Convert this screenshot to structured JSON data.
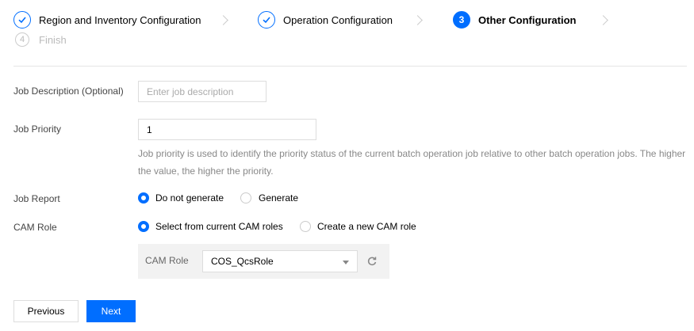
{
  "steps": [
    {
      "label": "Region and Inventory Configuration",
      "number": "",
      "state": "done"
    },
    {
      "label": "Operation Configuration",
      "number": "",
      "state": "done"
    },
    {
      "label": "Other Configuration",
      "number": "3",
      "state": "active"
    },
    {
      "label": "Finish",
      "number": "4",
      "state": "pending"
    }
  ],
  "form": {
    "job_description": {
      "label": "Job Description (Optional)",
      "placeholder": "Enter job description",
      "value": ""
    },
    "job_priority": {
      "label": "Job Priority",
      "value": "1",
      "hint": "Job priority is used to identify the priority status of the current batch operation job relative to other batch operation jobs. The higher the value, the higher the priority."
    },
    "job_report": {
      "label": "Job Report",
      "options": [
        "Do not generate",
        "Generate"
      ],
      "selected": "Do not generate"
    },
    "cam_role": {
      "label": "CAM Role",
      "options": [
        "Select from current CAM roles",
        "Create a new CAM role"
      ],
      "selected": "Select from current CAM roles",
      "select_label": "CAM Role",
      "select_value": "COS_QcsRole"
    }
  },
  "buttons": {
    "previous": "Previous",
    "next": "Next"
  },
  "colors": {
    "primary": "#006eff",
    "border": "#dddddd",
    "muted": "#888888"
  },
  "icons": {
    "done_step": "check-icon",
    "refresh": "refresh-icon",
    "dropdown": "caret-down-icon"
  }
}
